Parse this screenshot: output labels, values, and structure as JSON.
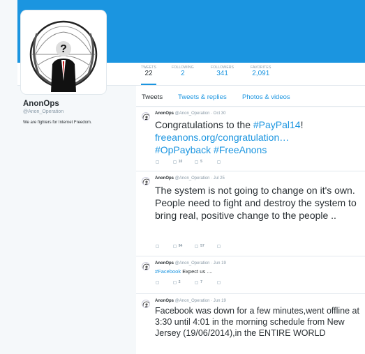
{
  "profile": {
    "name": "AnonOps",
    "handle": "@Anon_Operation",
    "bio": "We are fighters for Internet Freedom."
  },
  "stats": [
    {
      "label": "TWEETS",
      "value": "22"
    },
    {
      "label": "FOLLOWING",
      "value": "2"
    },
    {
      "label": "FOLLOWERS",
      "value": "341"
    },
    {
      "label": "FAVORITES",
      "value": "2,091"
    }
  ],
  "tabs": [
    "Tweets",
    "Tweets & replies",
    "Photos & videos"
  ],
  "tweets": [
    {
      "name": "AnonOps",
      "handle": "@Anon_Operation",
      "date": "· Oct 30",
      "text_plain": "Congratulations to the ",
      "text_link1": "#PayPal14",
      "text_end": "!",
      "text_link2": "freeanons.org/congratulation…",
      "text_link3": "#OpPayback #FreeAnons",
      "retweets": "10",
      "favorites": "5"
    },
    {
      "name": "AnonOps",
      "handle": "@Anon_Operation",
      "date": "· Jul 25",
      "text": "The system is not going to change on it's own. People need to fight and destroy the system to bring real, positive change to the people ..",
      "retweets": "94",
      "favorites": "57"
    },
    {
      "name": "AnonOps",
      "handle": "@Anon_Operation",
      "date": "· Jun 19",
      "text_link": "#Facebook",
      "text_rest": " Expect us ....",
      "retweets": "2",
      "favorites": "7"
    },
    {
      "name": "AnonOps",
      "handle": "@Anon_Operation",
      "date": "· Jun 19",
      "text": "Facebook was down for a few minutes,went offline at 3:30 until 4:01 in the morning schedule from New Jersey (19/06/2014),in the ENTIRE WORLD"
    }
  ]
}
